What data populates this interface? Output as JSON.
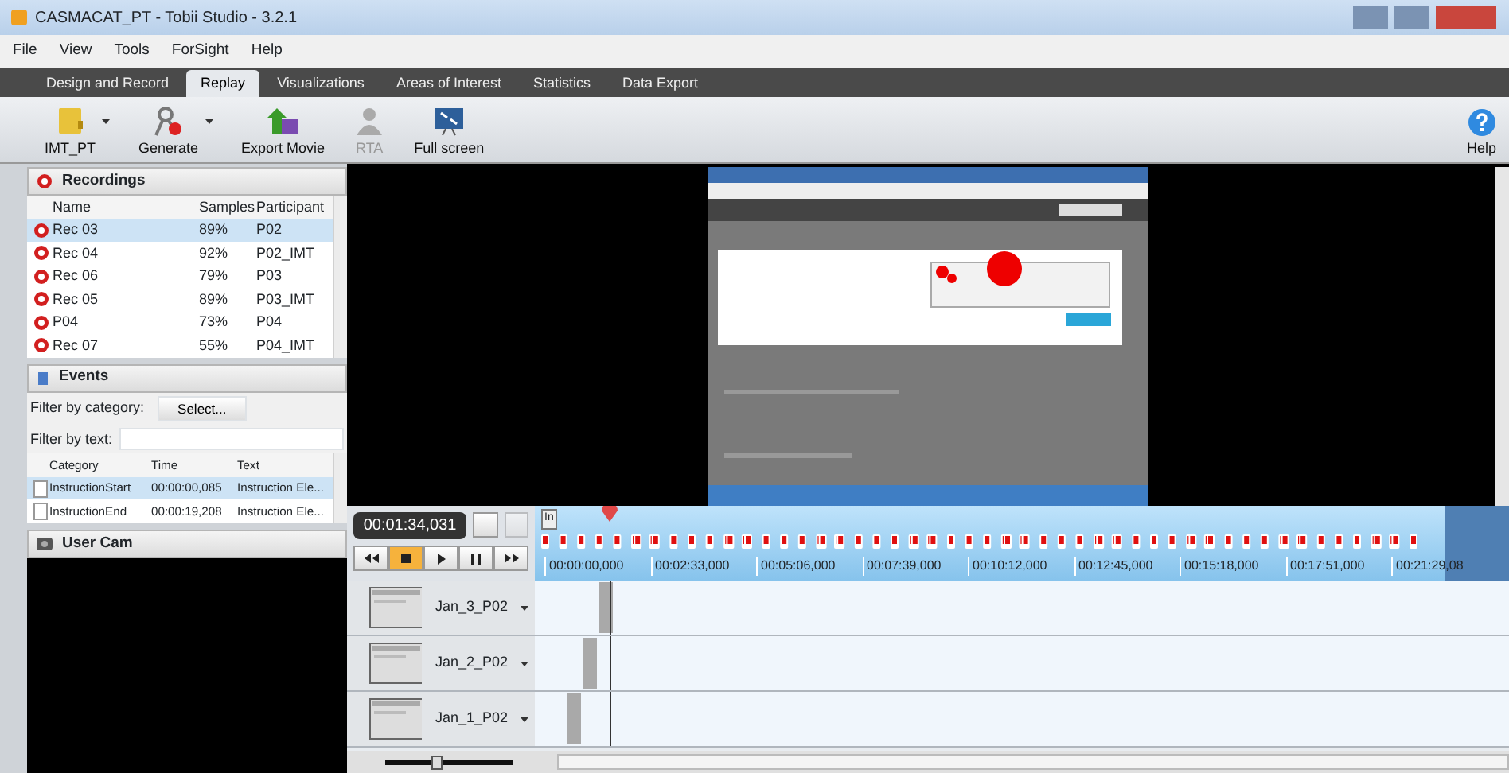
{
  "window": {
    "title": "CASMACAT_PT - Tobii Studio - 3.2.1"
  },
  "menu": [
    "File",
    "View",
    "Tools",
    "ForSight",
    "Help"
  ],
  "tabs": [
    {
      "label": "Design and Record",
      "selected": false
    },
    {
      "label": "Replay",
      "selected": true
    },
    {
      "label": "Visualizations",
      "selected": false
    },
    {
      "label": "Areas of Interest",
      "selected": false
    },
    {
      "label": "Statistics",
      "selected": false
    },
    {
      "label": "Data Export",
      "selected": false
    }
  ],
  "toolbar": [
    {
      "kind": "folder",
      "label": "IMT_PT",
      "dropdown": true,
      "disabled": false
    },
    {
      "kind": "generate",
      "label": "Generate",
      "dropdown": true,
      "disabled": false
    },
    {
      "kind": "export",
      "label": "Export Movie",
      "dropdown": false,
      "disabled": false
    },
    {
      "kind": "person",
      "label": "RTA",
      "dropdown": false,
      "disabled": true
    },
    {
      "kind": "screen",
      "label": "Full screen",
      "dropdown": false,
      "disabled": false
    }
  ],
  "help": {
    "label": "Help"
  },
  "recordings": {
    "title": "Recordings",
    "columns": [
      "Name",
      "Samples",
      "Participant"
    ],
    "rows": [
      {
        "cells": [
          "Rec 03",
          "89%",
          "P02"
        ],
        "selected": true
      },
      {
        "cells": [
          "Rec 04",
          "92%",
          "P02_IMT"
        ],
        "selected": false
      },
      {
        "cells": [
          "Rec 06",
          "79%",
          "P03"
        ],
        "selected": false
      },
      {
        "cells": [
          "Rec 05",
          "89%",
          "P03_IMT"
        ],
        "selected": false
      },
      {
        "cells": [
          "P04",
          "73%",
          "P04"
        ],
        "selected": false
      },
      {
        "cells": [
          "Rec 07",
          "55%",
          "P04_IMT"
        ],
        "selected": false
      }
    ]
  },
  "events": {
    "title": "Events",
    "filter_category_label": "Filter by category:",
    "select_button": "Select...",
    "filter_text_label": "Filter by text:",
    "columns": [
      "Category",
      "Time",
      "Text"
    ],
    "rows": [
      {
        "cells": [
          "InstructionStart",
          "00:00:00,085",
          "Instruction Ele..."
        ],
        "selected": true
      },
      {
        "cells": [
          "InstructionEnd",
          "00:00:19,208",
          "Instruction Ele..."
        ],
        "selected": false
      }
    ]
  },
  "user_cam": {
    "title": "User Cam"
  },
  "video": {
    "kind": "picture"
  },
  "player": {
    "time": "00:01:34,031",
    "in_marker": "In",
    "ticks": [
      "00:00:00,000",
      "00:02:33,000",
      "00:05:06,000",
      "00:07:39,000",
      "00:10:12,000",
      "00:12:45,000",
      "00:15:18,000",
      "00:17:51,000",
      "00:21:29,08"
    ]
  },
  "zoom": {
    "level": 0.4
  },
  "tracks": [
    {
      "name": "Jan_3_P02"
    },
    {
      "name": "Jan_2_P02"
    },
    {
      "name": "Jan_1_P02"
    }
  ]
}
